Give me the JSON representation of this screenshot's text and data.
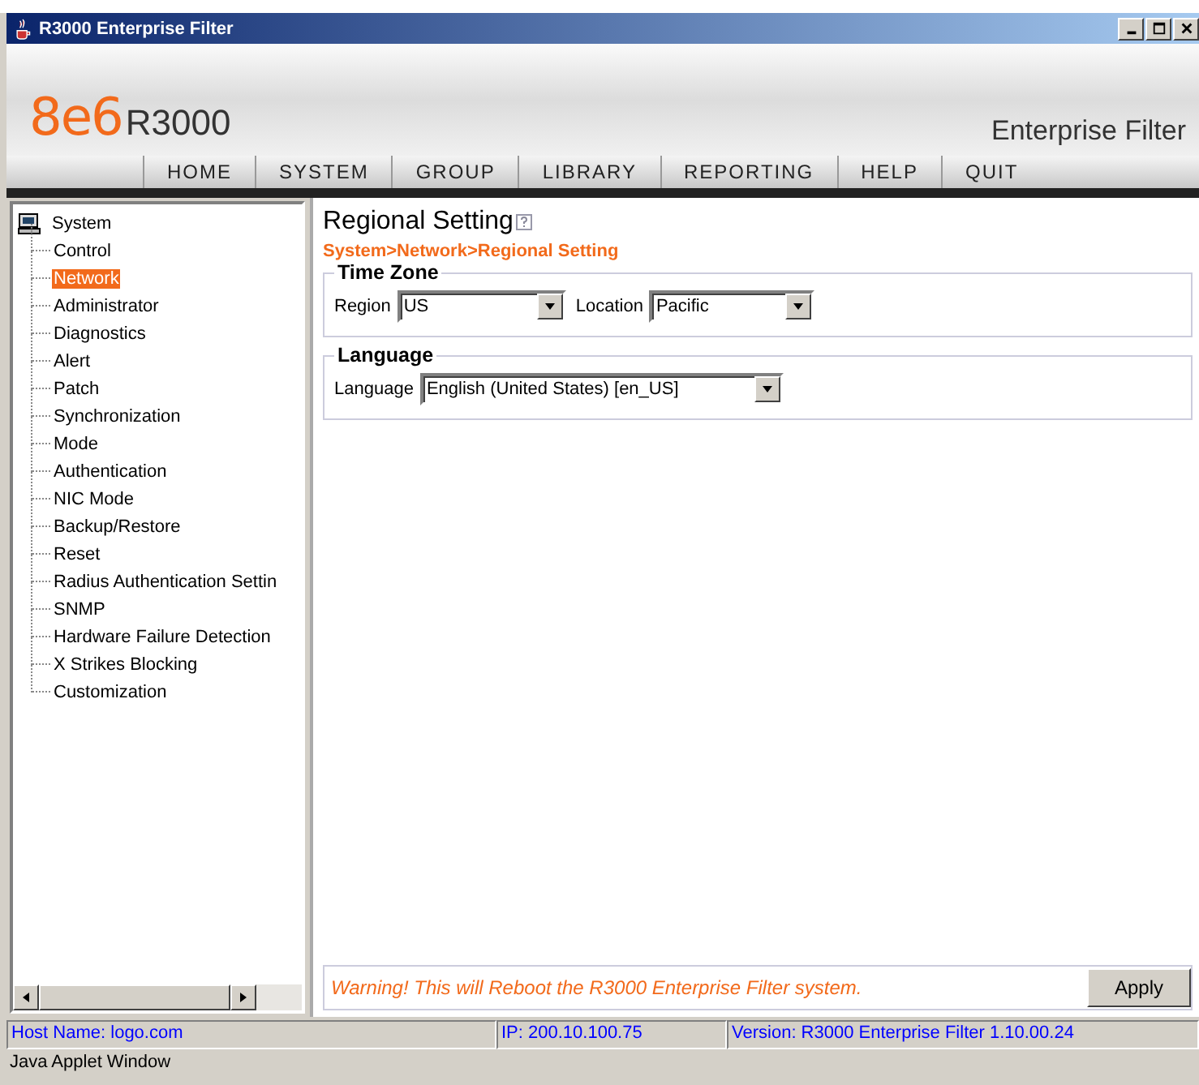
{
  "window": {
    "title": "R3000 Enterprise Filter"
  },
  "header": {
    "logo_brand": "8e6",
    "logo_product": "R3000",
    "subtitle": "Enterprise Filter"
  },
  "menu": [
    "HOME",
    "SYSTEM",
    "GROUP",
    "LIBRARY",
    "REPORTING",
    "HELP",
    "QUIT"
  ],
  "tree": {
    "label": "System",
    "selected": false,
    "children": [
      {
        "label": "Control",
        "selected": false
      },
      {
        "label": "Network",
        "selected": true
      },
      {
        "label": "Administrator",
        "selected": false
      },
      {
        "label": "Diagnostics",
        "selected": false
      },
      {
        "label": "Alert",
        "selected": false
      },
      {
        "label": "Patch",
        "selected": false
      },
      {
        "label": "Synchronization",
        "selected": false
      },
      {
        "label": "Mode",
        "selected": false
      },
      {
        "label": "Authentication",
        "selected": false
      },
      {
        "label": "NIC Mode",
        "selected": false
      },
      {
        "label": "Backup/Restore",
        "selected": false
      },
      {
        "label": "Reset",
        "selected": false
      },
      {
        "label": "Radius Authentication Settin",
        "selected": false
      },
      {
        "label": "SNMP",
        "selected": false
      },
      {
        "label": "Hardware Failure Detection",
        "selected": false
      },
      {
        "label": "X Strikes Blocking",
        "selected": false
      },
      {
        "label": "Customization",
        "selected": false
      }
    ]
  },
  "page": {
    "title": "Regional Setting",
    "breadcrumb": "System>Network>Regional Setting",
    "sections": [
      {
        "title": "Time Zone",
        "fields": [
          {
            "label": "Region",
            "value": "US"
          },
          {
            "label": "Location",
            "value": "Pacific"
          }
        ]
      },
      {
        "title": "Language",
        "fields": [
          {
            "label": "Language",
            "value": "English (United States) [en_US]"
          }
        ]
      }
    ]
  },
  "footer": {
    "warning": "Warning! This will Reboot the R3000 Enterprise Filter system.",
    "button": "Apply"
  },
  "status_bar": [
    "Host Name: logo.com",
    "IP: 200.10.100.75",
    "Version: R3000 Enterprise Filter 1.10.00.24"
  ],
  "applet_label": "Java Applet Window"
}
